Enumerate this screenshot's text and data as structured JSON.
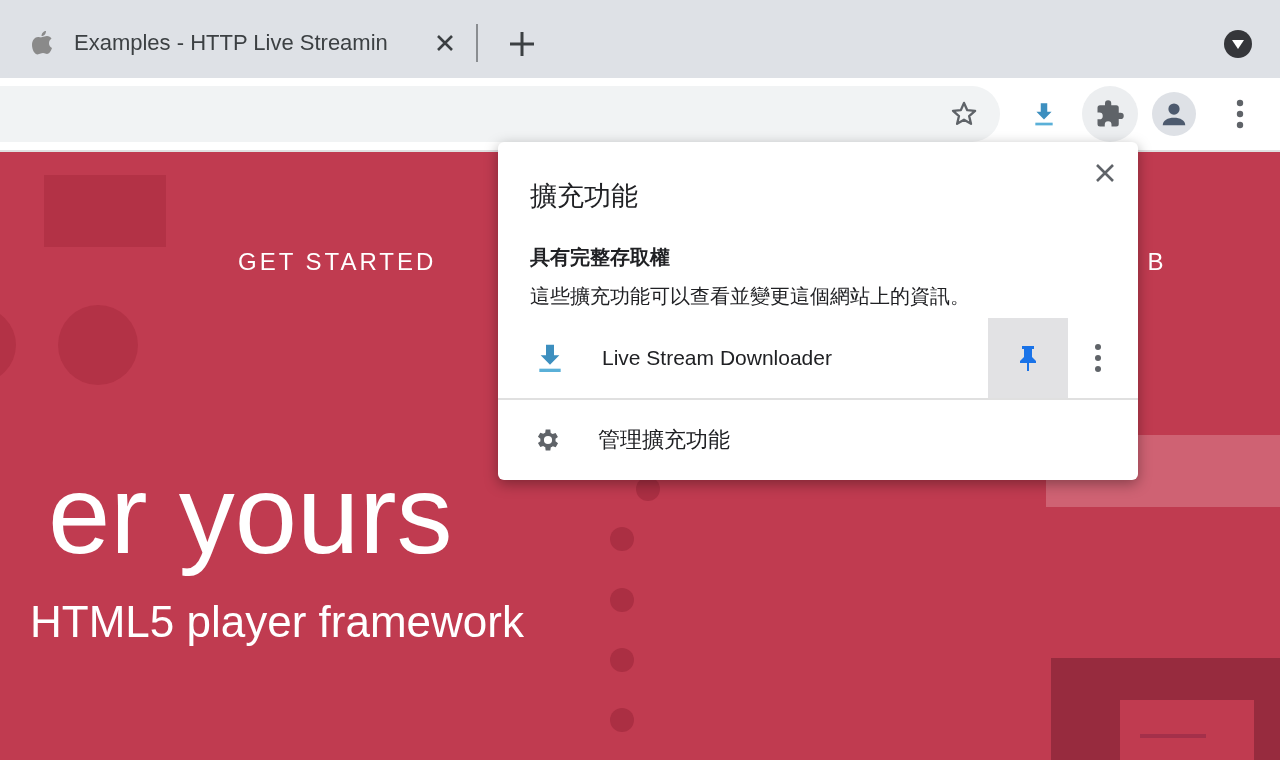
{
  "tab": {
    "title": "Examples - HTTP Live Streamin"
  },
  "page": {
    "nav": [
      "GET STARTED",
      "B"
    ],
    "headline": "er yours",
    "subtitle": "HTML5 player framework"
  },
  "popup": {
    "title": "擴充功能",
    "section_heading": "具有完整存取權",
    "section_text": "這些擴充功能可以查看並變更這個網站上的資訊。",
    "extensions": [
      {
        "name": "Live Stream Downloader",
        "pinned": true
      }
    ],
    "manage": "管理擴充功能"
  }
}
